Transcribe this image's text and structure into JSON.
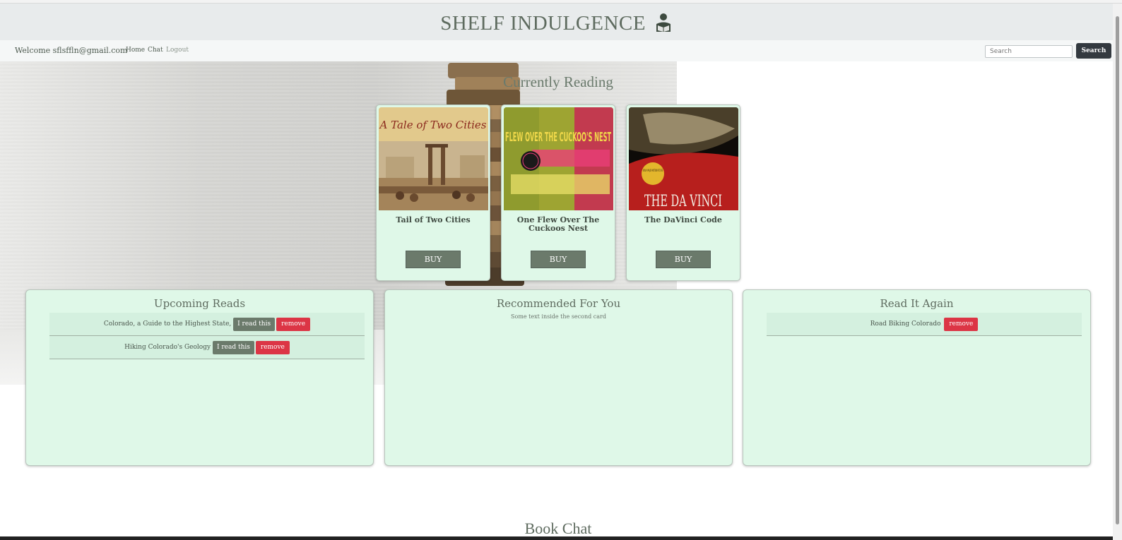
{
  "header": {
    "title": "SHELF INDULGENCE"
  },
  "nav": {
    "welcome": "Welcome sflsffln@gmail.com",
    "links": [
      "Home",
      "Chat",
      "Logout"
    ],
    "search_placeholder": "Search",
    "search_button": "Search"
  },
  "currently_reading": {
    "title": "Currently Reading",
    "books": [
      {
        "title": "Tail of Two Cities",
        "cover_text": "A Tale of Two Cities",
        "button": "BUY"
      },
      {
        "title": "One Flew Over The Cuckoos Nest",
        "cover_text": "FLEW OVER THE CUCKOO'S NEST",
        "button": "BUY"
      },
      {
        "title": "The DaVinci Code",
        "cover_text": "THE DA VINCI",
        "cover_badge": "NOW A MAJOR MOTION PICTURE",
        "button": "BUY"
      }
    ]
  },
  "upcoming": {
    "title": "Upcoming Reads",
    "items": [
      {
        "name": "Colorado, a Guide to the Highest State,",
        "read_label": "I read this",
        "remove_label": "remove"
      },
      {
        "name": "Hiking Colorado's Geology",
        "read_label": "I read this",
        "remove_label": "remove"
      }
    ]
  },
  "recommended": {
    "title": "Recommended For You",
    "text": "Some text inside the second card"
  },
  "read_again": {
    "title": "Read It Again",
    "items": [
      {
        "name": "Road Biking Colorado",
        "remove_label": "remove"
      }
    ]
  },
  "book_chat": {
    "title": "Book Chat"
  },
  "colors": {
    "card_bg": "#dff8e8",
    "buy_button": "#6b7a6b",
    "remove_button": "#dc3545",
    "search_button": "#343a40"
  }
}
